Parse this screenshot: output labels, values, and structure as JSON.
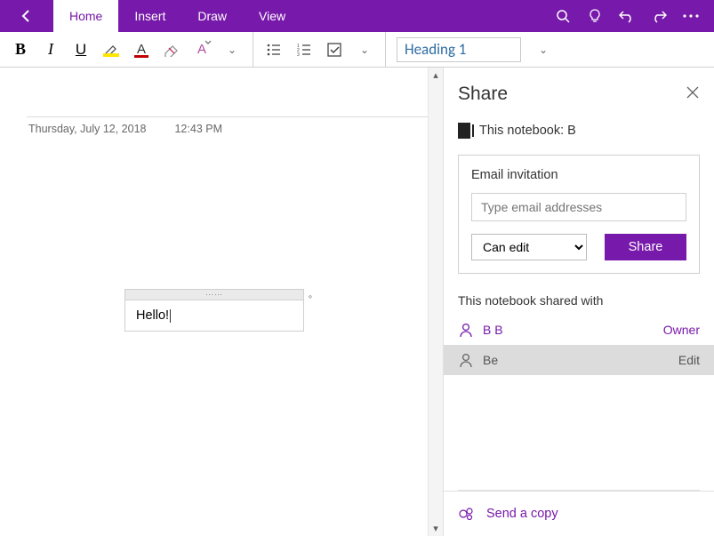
{
  "titlebar": {
    "tabs": {
      "home": "Home",
      "insert": "Insert",
      "draw": "Draw",
      "view": "View"
    }
  },
  "ribbon": {
    "style_label": "Heading 1"
  },
  "page": {
    "date": "Thursday, July 12, 2018",
    "time": "12:43 PM",
    "text": "Hello!"
  },
  "share": {
    "title": "Share",
    "notebook_label": "This notebook: B",
    "invite_label": "Email invitation",
    "email_placeholder": "Type email addresses",
    "permission": "Can edit",
    "share_btn": "Share",
    "shared_with_label": "This notebook shared with",
    "users": [
      {
        "name": "B B",
        "role": "Owner"
      },
      {
        "name": "Be",
        "role": "Edit"
      }
    ],
    "send_copy": "Send a copy"
  },
  "colors": {
    "accent": "#7719AA"
  }
}
